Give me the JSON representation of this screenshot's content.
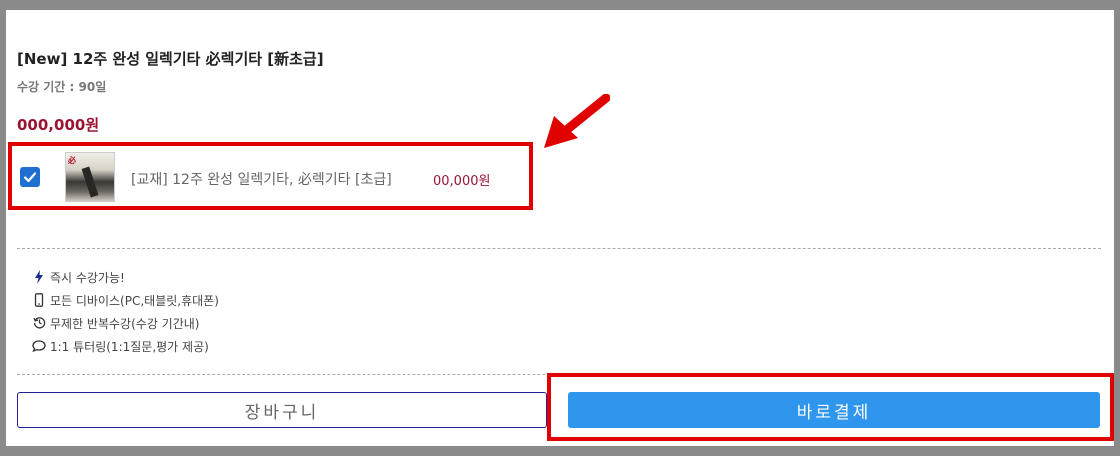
{
  "product": {
    "title": "[New] 12주 완성 일렉기타 必렉기타 [新초급]",
    "period": "수강 기간 : 90일",
    "price": "000,000원"
  },
  "option": {
    "checked": true,
    "label": "[교재] 12주 완성 일렉기타, 必렉기타 [초급]",
    "price": "00,000원",
    "thumbnail_text": "必"
  },
  "features": [
    {
      "icon": "lightning-icon",
      "text": "즉시 수강가능!"
    },
    {
      "icon": "mobile-icon",
      "text": "모든 디바이스(PC,태블릿,휴대폰)"
    },
    {
      "icon": "history-icon",
      "text": "무제한 반복수강(수강 기간내)"
    },
    {
      "icon": "chat-icon",
      "text": "1:1 튜터링(1:1질문,평가 제공)"
    }
  ],
  "buttons": {
    "cart": "장바구니",
    "buy": "바로결제"
  },
  "colors": {
    "price": "#9a1434",
    "buy_button": "#2f96ee",
    "highlight": "#e00000",
    "checkbox": "#1f6fd1"
  }
}
